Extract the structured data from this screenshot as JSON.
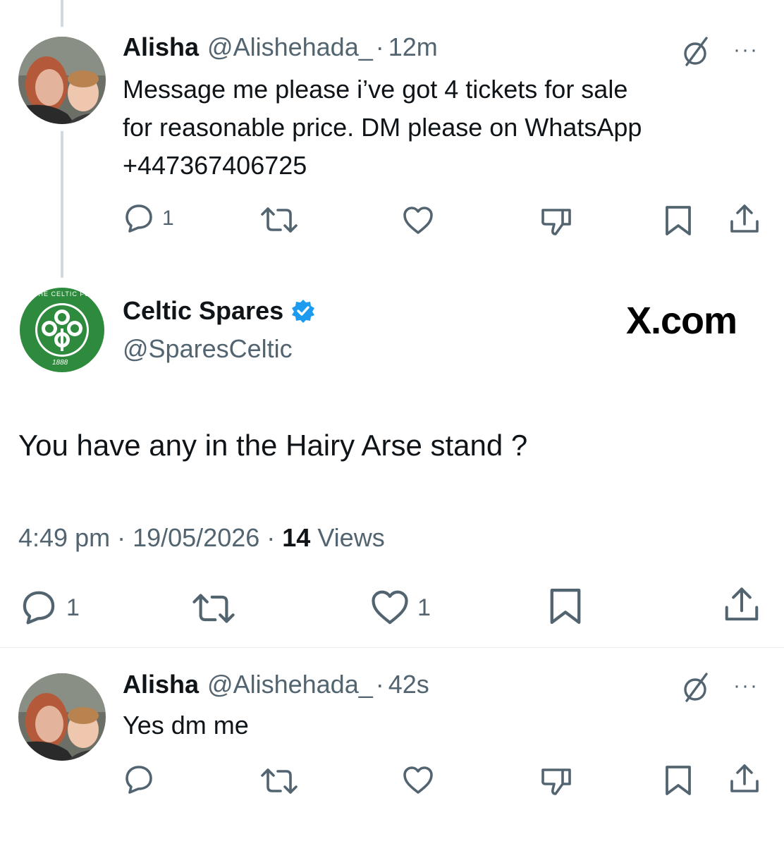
{
  "tweet1": {
    "name": "Alisha",
    "handle": "@Alishehada_",
    "separator": "·",
    "time": "12m",
    "lines": [
      "Message me please i’ve got 4 tickets for sale",
      "for reasonable price. DM please on WhatsApp",
      "+447367406725"
    ],
    "reply_count": "1",
    "more": "···"
  },
  "main_tweet": {
    "name": "Celtic Spares",
    "handle": "@SparesCeltic",
    "watermark": "X.com",
    "text": "You have any in the Hairy Arse stand ?",
    "time": "4:49 pm",
    "date": "19/05/2026",
    "separator": "·",
    "views_count": "14",
    "views_label": "Views",
    "reply_count": "1",
    "like_count": "1",
    "avatar_logo": {
      "ring_text": "THE CELTIC FOOTBALL CLUB",
      "year": "1888"
    }
  },
  "tweet3": {
    "name": "Alisha",
    "handle": "@Alishehada_",
    "separator": "·",
    "time": "42s",
    "text": "Yes dm me",
    "more": "···"
  },
  "colors": {
    "text": "#0f1419",
    "muted": "#536471",
    "verified": "#1d9bf0",
    "celtic_green": "#2e8b3d",
    "thread_line": "#cfd9de"
  }
}
